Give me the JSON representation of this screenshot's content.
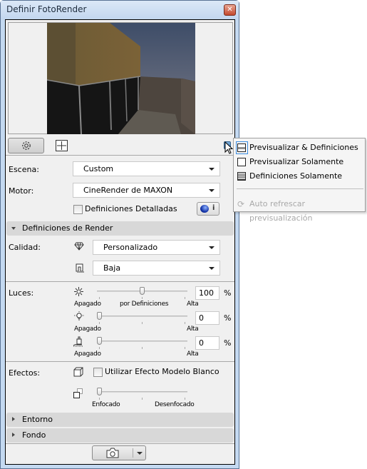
{
  "window": {
    "title": "Definir FotoRender",
    "close_icon": "close-icon"
  },
  "toolbar": {
    "settings_icon": "gear-icon",
    "size_icon": "frame-size-icon",
    "menu_button_icon": "view-mode-menu-icon"
  },
  "settings": {
    "scene_label": "Escena:",
    "scene_value": "Custom",
    "engine_label": "Motor:",
    "engine_value": "CineRender de MAXON",
    "detailed_label": "Definiciones Detalladas",
    "detailed_checked": false,
    "info_button_label": "i"
  },
  "render_section": {
    "title": "Definiciones de Render",
    "expanded": true,
    "quality_label": "Calidad:",
    "quality_value": "Personalizado",
    "quality2_value": "Baja"
  },
  "lights": {
    "label": "Luces:",
    "sliders": [
      {
        "icon": "sun-icon",
        "value": "100",
        "fraction": 0.5,
        "unit": "%",
        "left_label": "Apagado",
        "mid_label": "por Definiciones",
        "right_label": "Alta"
      },
      {
        "icon": "lightbulb-icon",
        "value": "0",
        "fraction": 0.0,
        "unit": "%",
        "left_label": "Apagado",
        "mid_label": "",
        "right_label": "Alta"
      },
      {
        "icon": "brush-light-icon",
        "value": "0",
        "fraction": 0.0,
        "unit": "%",
        "left_label": "Apagado",
        "mid_label": "",
        "right_label": "Alta"
      }
    ]
  },
  "effects": {
    "label": "Efectos:",
    "white_model_label": "Utilizar Efecto Modelo Blanco",
    "white_model_checked": false,
    "blur_fraction": 0.0,
    "blur_left": "Enfocado",
    "blur_right": "Desenfocado"
  },
  "sections": [
    {
      "title": "Entorno",
      "expanded": false
    },
    {
      "title": "Fondo",
      "expanded": false
    }
  ],
  "footer": {
    "render_icon": "camera-icon",
    "dropdown_icon": "chevron-down-icon"
  },
  "popup_menu": {
    "items": [
      {
        "label": "Previsualizar & Definiciones",
        "selected": true,
        "enabled": true
      },
      {
        "label": "Previsualizar Solamente",
        "selected": false,
        "enabled": true
      },
      {
        "label": "Definiciones Solamente",
        "selected": false,
        "enabled": true
      },
      {
        "label": "Auto refrescar previsualización",
        "selected": false,
        "enabled": false
      }
    ]
  }
}
